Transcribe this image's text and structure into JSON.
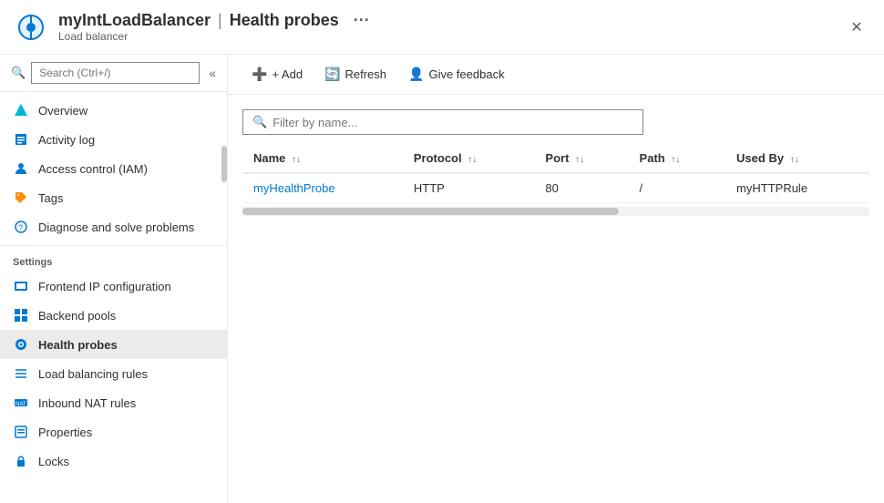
{
  "header": {
    "resource_name": "myIntLoadBalancer",
    "page_title": "Health probes",
    "resource_type": "Load balancer",
    "more_icon": "···",
    "close_icon": "✕"
  },
  "sidebar": {
    "search_placeholder": "Search (Ctrl+/)",
    "collapse_icon": "«",
    "nav_items": [
      {
        "id": "overview",
        "label": "Overview",
        "icon": "diamond"
      },
      {
        "id": "activity-log",
        "label": "Activity log",
        "icon": "doc"
      },
      {
        "id": "access-control",
        "label": "Access control (IAM)",
        "icon": "person"
      },
      {
        "id": "tags",
        "label": "Tags",
        "icon": "tag"
      },
      {
        "id": "diagnose",
        "label": "Diagnose and solve problems",
        "icon": "wrench"
      }
    ],
    "settings_label": "Settings",
    "settings_items": [
      {
        "id": "frontend-ip",
        "label": "Frontend IP configuration",
        "icon": "frontend"
      },
      {
        "id": "backend-pools",
        "label": "Backend pools",
        "icon": "backend"
      },
      {
        "id": "health-probes",
        "label": "Health probes",
        "icon": "probe",
        "active": true
      },
      {
        "id": "load-balancing-rules",
        "label": "Load balancing rules",
        "icon": "rules"
      },
      {
        "id": "inbound-nat",
        "label": "Inbound NAT rules",
        "icon": "nat"
      },
      {
        "id": "properties",
        "label": "Properties",
        "icon": "props"
      },
      {
        "id": "locks",
        "label": "Locks",
        "icon": "lock"
      }
    ]
  },
  "toolbar": {
    "add_label": "+ Add",
    "refresh_label": "Refresh",
    "feedback_label": "Give feedback"
  },
  "table": {
    "filter_placeholder": "Filter by name...",
    "columns": [
      {
        "key": "name",
        "label": "Name"
      },
      {
        "key": "protocol",
        "label": "Protocol"
      },
      {
        "key": "port",
        "label": "Port"
      },
      {
        "key": "path",
        "label": "Path"
      },
      {
        "key": "used_by",
        "label": "Used By"
      }
    ],
    "rows": [
      {
        "name": "myHealthProbe",
        "protocol": "HTTP",
        "port": "80",
        "path": "/",
        "used_by": "myHTTPRule"
      }
    ]
  }
}
